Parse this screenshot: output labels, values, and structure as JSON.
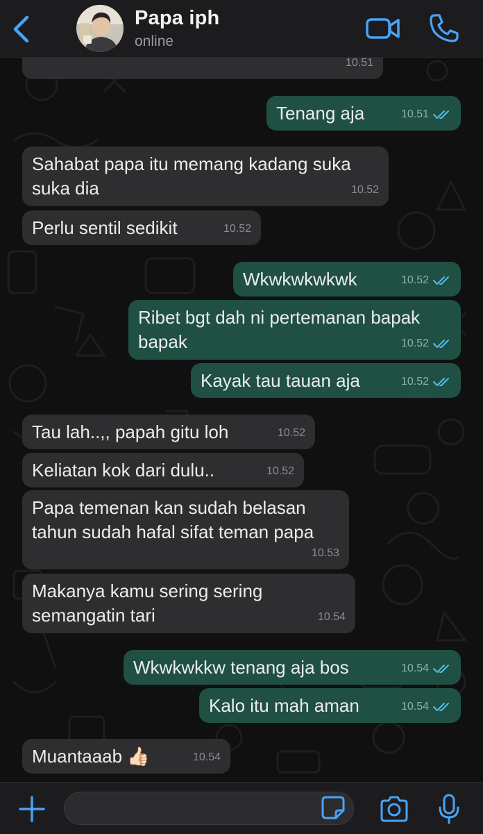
{
  "header": {
    "contact_name": "Papa iph",
    "status": "online",
    "icons": {
      "back": "chevron-left-icon",
      "video": "video-camera-icon",
      "call": "phone-icon"
    }
  },
  "colors": {
    "accent": "#4aa3f5",
    "incoming_bubble": "#2e2e30",
    "outgoing_bubble": "#1f5043",
    "read_ticks": "#53bdeb"
  },
  "messages": [
    {
      "direction": "in",
      "text": "",
      "time": "10.51"
    },
    {
      "direction": "out",
      "text": "Tenang aja",
      "time": "10.51",
      "status": "read"
    },
    {
      "direction": "in",
      "text": "Sahabat papa itu memang kadang suka\nsuka dia",
      "time": "10.52"
    },
    {
      "direction": "in",
      "text": "Perlu sentil sedikit",
      "time": "10.52"
    },
    {
      "direction": "out",
      "text": "Wkwkwkwkwk",
      "time": "10.52",
      "status": "read"
    },
    {
      "direction": "out",
      "text": "Ribet bgt dah ni pertemanan bapak\nbapak",
      "time": "10.52",
      "status": "read"
    },
    {
      "direction": "out",
      "text": "Kayak tau tauan aja",
      "time": "10.52",
      "status": "read"
    },
    {
      "direction": "in",
      "text": "Tau lah..,, papah gitu loh",
      "time": "10.52"
    },
    {
      "direction": "in",
      "text": "Keliatan kok dari dulu..",
      "time": "10.52"
    },
    {
      "direction": "in",
      "text": "Papa temenan kan sudah belasan\ntahun sudah hafal sifat teman papa",
      "time": "10.53"
    },
    {
      "direction": "in",
      "text": "Makanya kamu sering sering\nsemangatin tari",
      "time": "10.54"
    },
    {
      "direction": "out",
      "text": "Wkwkwkkw tenang aja bos",
      "time": "10.54",
      "status": "read"
    },
    {
      "direction": "out",
      "text": "Kalo itu mah aman",
      "time": "10.54",
      "status": "read"
    },
    {
      "direction": "in",
      "text": "Muantaaab 👍🏻",
      "time": "10.54"
    }
  ],
  "input": {
    "placeholder": "",
    "icons": {
      "attach": "plus-icon",
      "sticker": "sticker-icon",
      "camera": "camera-icon",
      "mic": "microphone-icon"
    }
  }
}
